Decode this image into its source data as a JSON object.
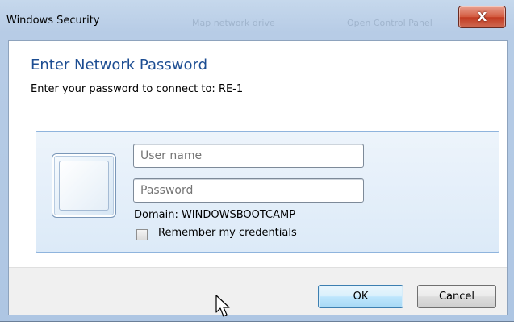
{
  "window": {
    "title": "Windows Security",
    "close_label": "X"
  },
  "background_ghosts": [
    "Map network drive",
    "Open Control Panel"
  ],
  "dialog": {
    "heading": "Enter Network Password",
    "subtitle": "Enter your password to connect to: RE-1"
  },
  "credentials": {
    "username_placeholder": "User name",
    "password_placeholder": "Password",
    "domain_text": "Domain: WINDOWSBOOTCAMP",
    "remember_label": "Remember my credentials",
    "remember_checked": false
  },
  "buttons": {
    "ok_label": "OK",
    "cancel_label": "Cancel"
  },
  "colors": {
    "heading": "#1c4d92",
    "close_button": "#c13a21",
    "panel": "#dceaf8"
  }
}
